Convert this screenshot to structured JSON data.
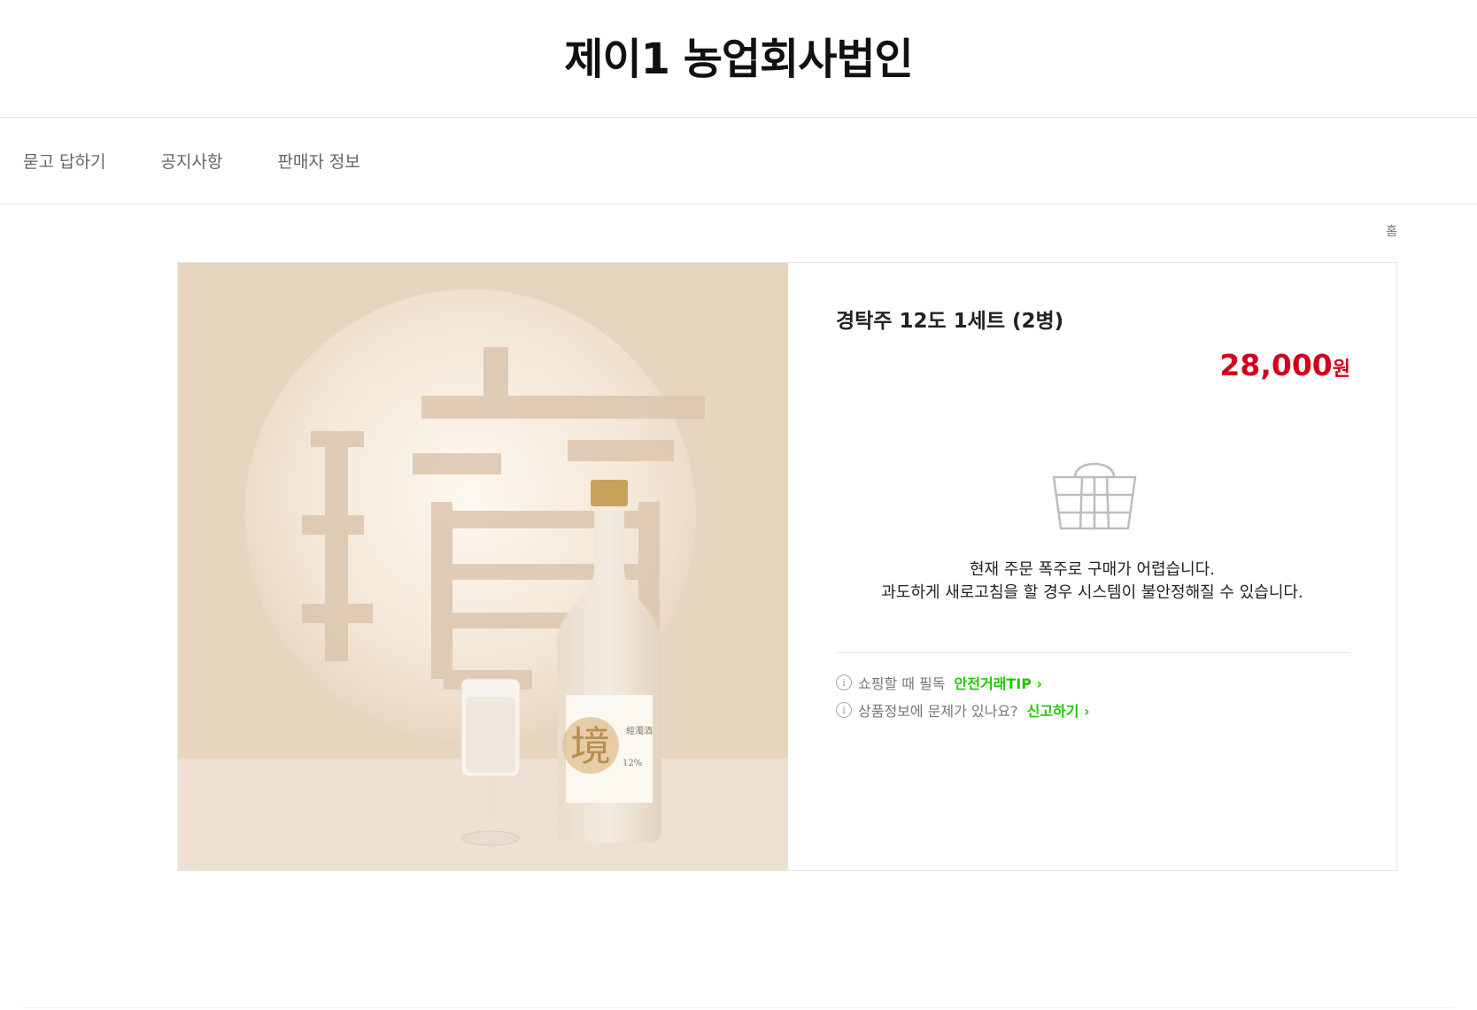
{
  "store": {
    "title": "제이1 농업회사법인"
  },
  "nav": {
    "items": [
      "묻고 답하기",
      "공지사항",
      "판매자 정보"
    ]
  },
  "breadcrumb": {
    "home": "홈"
  },
  "product": {
    "name": "경탁주 12도 1세트 (2병)",
    "price": "28,000",
    "price_unit": "원",
    "soldout_line1": "현재 주문 폭주로 구매가 어렵습니다.",
    "soldout_line2": "과도하게 새로고침을 할 경우 시스템이 불안정해질 수 있습니다.",
    "image": {
      "label_char": "境",
      "label_sub": "12%"
    }
  },
  "notices": [
    {
      "text": "쇼핑할 때 필독",
      "link": "안전거래TIP"
    },
    {
      "text": "상품정보에 문제가 있나요?",
      "link": "신고하기"
    }
  ],
  "colors": {
    "price": "#d0021b",
    "link": "#1ec800",
    "image_bg": "#e8d5c0"
  }
}
